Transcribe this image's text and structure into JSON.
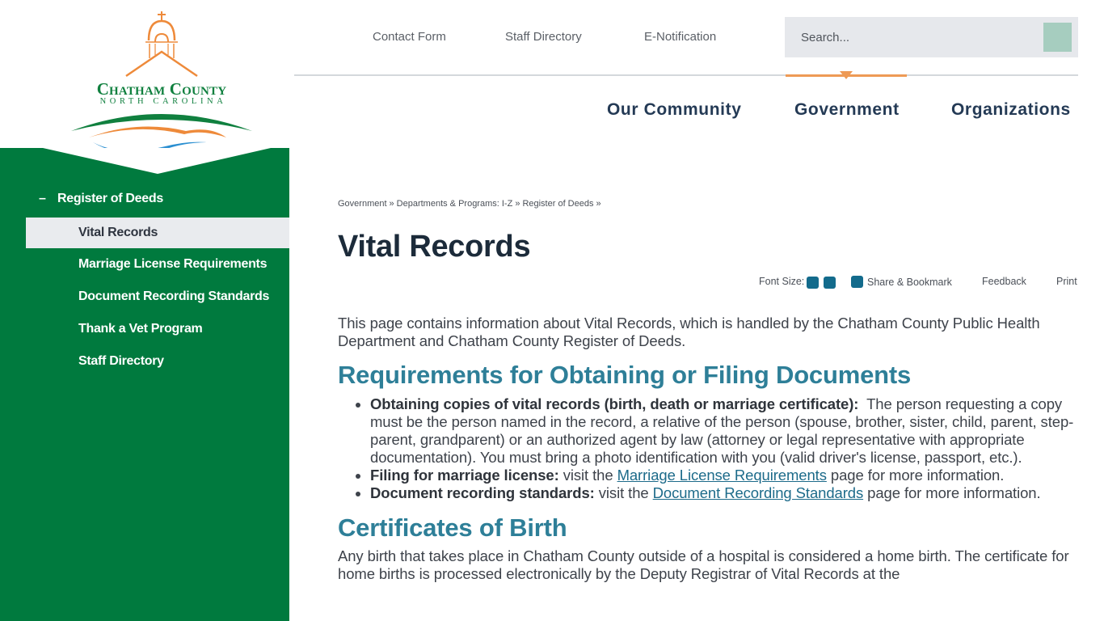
{
  "logo": {
    "name_main": "Chatham County",
    "name_sub": "North Carolina",
    "colors": {
      "green": "#10803f",
      "orange": "#ee8a3a",
      "blue": "#2b8fd1"
    }
  },
  "utility_nav": {
    "links": [
      "Contact Form",
      "Staff Directory",
      "E-Notification"
    ]
  },
  "search": {
    "placeholder": "Search...",
    "button_label": "",
    "icon": "search-icon"
  },
  "main_nav": {
    "items": [
      "Our Community",
      "Government",
      "Organizations"
    ],
    "active": "Government",
    "accent_color": "#ee9a55"
  },
  "sidebar": {
    "parent": {
      "marker": "–",
      "label": "Register of Deeds"
    },
    "items": [
      {
        "label": "Vital Records",
        "active": true
      },
      {
        "label": "Marriage License Requirements",
        "active": false
      },
      {
        "label": "Document Recording Standards",
        "active": false
      },
      {
        "label": "Thank a Vet Program",
        "active": false
      },
      {
        "label": "Staff Directory",
        "active": false
      }
    ],
    "bg_color": "#007a3e"
  },
  "breadcrumb": {
    "items": [
      "Government",
      "Departments & Programs: I-Z",
      "Register of Deeds"
    ],
    "separator": "»"
  },
  "page": {
    "title": "Vital Records"
  },
  "page_tools": {
    "font_size_label": "Font Size:",
    "share_label": "Share & Bookmark",
    "feedback_label": "Feedback",
    "print_label": "Print"
  },
  "content": {
    "intro": "This page contains information about Vital Records, which is handled by the Chatham County Public Health Department and Chatham County Register of Deeds.",
    "section1": {
      "heading": "Requirements for Obtaining or Filing Documents",
      "bullets": [
        {
          "bold": "Obtaining copies of vital records (birth, death or marriage certificate):",
          "text": "  The person requesting a copy must be the person named in the record, a relative of the person (spouse, brother, sister, child, parent, step-parent, grandparent) or an authorized agent by law (attorney or legal representative with appropriate documentation). You must bring a photo identification with you (valid driver's license, passport, etc.)."
        },
        {
          "bold": "Filing for marriage license:",
          "pre": " visit the ",
          "link": "Marriage License Requirements",
          "post": " page for more information."
        },
        {
          "bold": "Document recording standards:",
          "pre": " visit the ",
          "link": "Document Recording Standards",
          "post": " page for more information."
        }
      ]
    },
    "section2": {
      "heading": "Certificates of Birth",
      "text": "Any birth that takes place in Chatham County outside of a hospital is considered a home birth. The certificate for home births is processed electronically by the Deputy Registrar of Vital Records at the"
    }
  }
}
